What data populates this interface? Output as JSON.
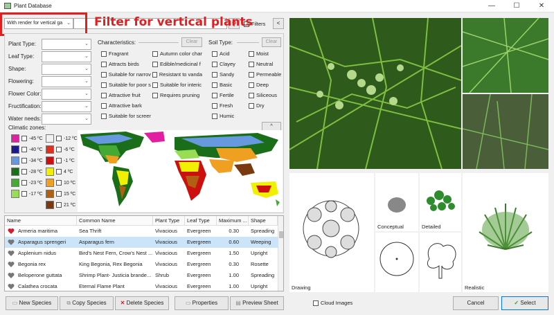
{
  "window": {
    "title": "Plant Database",
    "minimize": "—",
    "maximize": "☐",
    "close": "✕"
  },
  "toolbar": {
    "render_filter_value": "With render for vertical ga",
    "search_value": "",
    "filters_label": "Filters",
    "filters_checked": true,
    "collapse_label": "<"
  },
  "annotation": "Filter for vertical plants",
  "filters": {
    "fields": [
      {
        "label": "Plant Type:",
        "value": ""
      },
      {
        "label": "Leaf Type:",
        "value": ""
      },
      {
        "label": "Shape:",
        "value": ""
      },
      {
        "label": "Flowering:",
        "value": ""
      },
      {
        "label": "Flower Color:",
        "value": ""
      },
      {
        "label": "Fructification:",
        "value": ""
      },
      {
        "label": "Water needs:",
        "value": ""
      }
    ],
    "characteristics_label": "Characteristics:",
    "characteristics_clear": "Clear",
    "characteristics": [
      "Fragrant",
      "Autumn color char",
      "Attracts birds",
      "Edible/medicinal f",
      "Suitable for narrov",
      "Resistant to vanda",
      "Suitable for poor s",
      "Suitable for interic",
      "Attractive fruit",
      "Requires pruning",
      "Attractive bark",
      "",
      "Suitable for screer",
      ""
    ],
    "soil_label": "Soil Type:",
    "soil_clear": "Clear",
    "soil": [
      "Acid",
      "Moist",
      "Clayey",
      "Neutral",
      "Sandy",
      "Permeable",
      "Basic",
      "Deep",
      "Fertile",
      "Siliceous",
      "Fresh",
      "Dry",
      "Humic",
      ""
    ],
    "climatic_label": "Climatic zones:",
    "map_collapse": "^",
    "zones": [
      {
        "label": "-45 ºC",
        "color": "#e020a0"
      },
      {
        "label": "-12 ºC",
        "color": "#f0f0f0"
      },
      {
        "label": "-40 ºC",
        "color": "#1a1a8c"
      },
      {
        "label": "-6 ºC",
        "color": "#e03020"
      },
      {
        "label": "-34 ºC",
        "color": "#6699dd"
      },
      {
        "label": "-1 ºC",
        "color": "#cc1010"
      },
      {
        "label": "-28 ºC",
        "color": "#1a6e1a"
      },
      {
        "label": "4 ºC",
        "color": "#f0f000"
      },
      {
        "label": "-23 ºC",
        "color": "#44aa33"
      },
      {
        "label": "10 ºC",
        "color": "#f0a020"
      },
      {
        "label": "-17 ºC",
        "color": "#99dd55"
      },
      {
        "label": "15 ºC",
        "color": "#b06010"
      },
      {
        "label": "21 ºC",
        "color": "#7a3a10"
      }
    ]
  },
  "table": {
    "columns": [
      "Name",
      "Common Name",
      "Plant Type",
      "Leaf Type",
      "Maximum ...",
      "Shape"
    ],
    "rows": [
      {
        "fav": true,
        "name": "Armeria maritima",
        "common": "Sea Thrift",
        "type": "Vivacious",
        "leaf": "Evergreen",
        "max": "0.30",
        "shape": "Spreading"
      },
      {
        "fav": false,
        "name": "Asparagus sprengeri",
        "common": "Asparagus fern",
        "type": "Vivacious",
        "leaf": "Evergreen",
        "max": "0.60",
        "shape": "Weeping"
      },
      {
        "fav": false,
        "name": "Asplenium nidus",
        "common": "Bird's Nest Fern, Crow's Nest ...",
        "type": "Vivacious",
        "leaf": "Evergreen",
        "max": "1.50",
        "shape": "Upright"
      },
      {
        "fav": false,
        "name": "Begonia rex",
        "common": "King Begonia, Rex Begonia",
        "type": "Vivacious",
        "leaf": "Evergreen",
        "max": "0.30",
        "shape": "Rosette"
      },
      {
        "fav": false,
        "name": "Beloperone guttata",
        "common": "Shrimp Plant- Justicia brande...",
        "type": "Shrub",
        "leaf": "Evergreen",
        "max": "1.00",
        "shape": "Spreading"
      },
      {
        "fav": false,
        "name": "Calathea crocata",
        "common": "Eternal Flame Plant",
        "type": "Vivacious",
        "leaf": "Evergreen",
        "max": "1.00",
        "shape": "Upright"
      }
    ]
  },
  "buttons": {
    "new_species": "New Species",
    "copy_species": "Copy Species",
    "delete_species": "Delete Species",
    "properties": "Properties",
    "preview_sheet": "Preview Sheet",
    "cloud_images": "Cloud Images",
    "cancel": "Cancel",
    "select": "Select"
  },
  "preview": {
    "drawing": "Drawing",
    "conceptual": "Conceptual",
    "detailed": "Detailed",
    "realistic": "Realistic"
  }
}
